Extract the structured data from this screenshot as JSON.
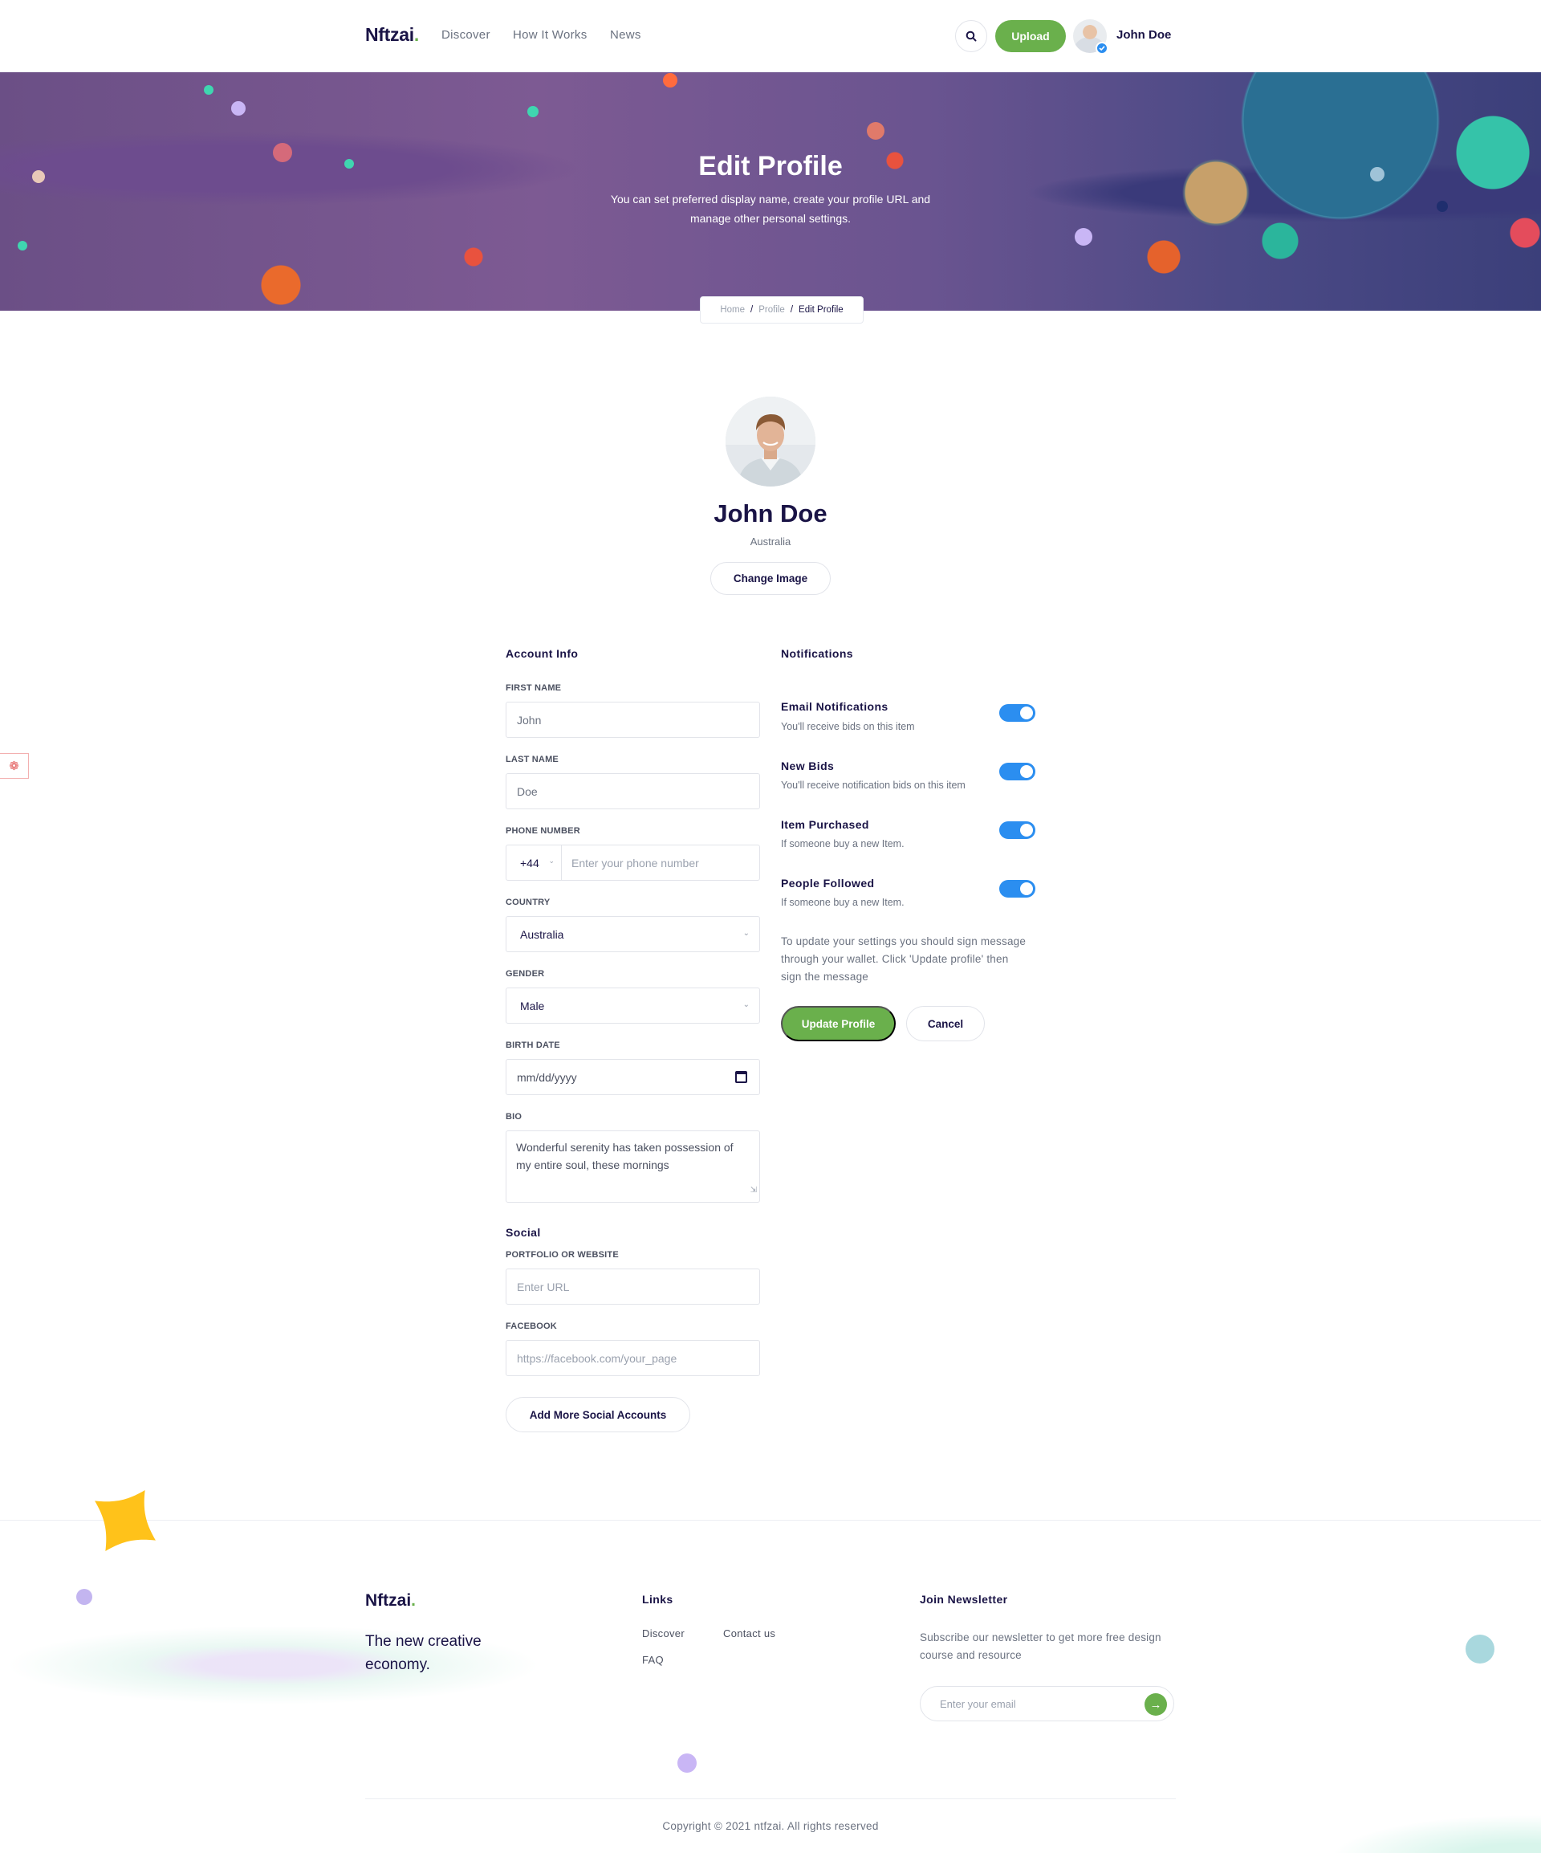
{
  "nav": {
    "logo": "Nftzai",
    "logo_dot": ".",
    "links": [
      "Discover",
      "How It Works",
      "News"
    ],
    "upload_label": "Upload",
    "user_name": "John Doe"
  },
  "hero": {
    "title": "Edit Profile",
    "subtitle": "You can set preferred display name, create your profile URL and manage other personal settings.",
    "breadcrumb": [
      "Home",
      "Profile",
      "Edit Profile"
    ],
    "breadcrumb_sep": "/"
  },
  "profile": {
    "name": "John Doe",
    "country": "Australia",
    "change_image_label": "Change Image"
  },
  "account": {
    "title": "Account Info",
    "first_name": {
      "label": "FIRST NAME",
      "value": "John"
    },
    "last_name": {
      "label": "LAST NAME",
      "value": "Doe"
    },
    "phone": {
      "label": "PHONE NUMBER",
      "code": "+44",
      "placeholder": "Enter your phone number"
    },
    "country": {
      "label": "COUNTRY",
      "value": "Australia"
    },
    "gender": {
      "label": "GENDER",
      "value": "Male"
    },
    "birth_date": {
      "label": "BIRTH DATE",
      "placeholder": "mm/dd/yyyy"
    },
    "bio": {
      "label": "BIO",
      "value": "Wonderful serenity has taken possession of my entire soul, these mornings"
    }
  },
  "social": {
    "title": "Social",
    "website": {
      "label": "PORTFOLIO OR WEBSITE",
      "placeholder": "Enter URL"
    },
    "facebook": {
      "label": "FACEBOOK",
      "placeholder": "https://facebook.com/your_page"
    },
    "add_more_label": "Add More Social Accounts"
  },
  "notifications": {
    "title": "Notifications",
    "items": [
      {
        "title": "Email Notifications",
        "desc": "You'll receive bids on this item",
        "enabled": true
      },
      {
        "title": "New Bids",
        "desc": "You'll receive notification bids on this item",
        "enabled": true
      },
      {
        "title": "Item Purchased",
        "desc": "If someone buy a new Item.",
        "enabled": true
      },
      {
        "title": "People Followed",
        "desc": "If someone buy a new Item.",
        "enabled": true
      }
    ],
    "notice": "To update your settings you should sign message through your wallet. Click 'Update profile' then sign the message",
    "update_label": "Update Profile",
    "cancel_label": "Cancel"
  },
  "footer": {
    "logo": "Nftzai",
    "logo_dot": ".",
    "tagline": "The new creative economy.",
    "links_title": "Links",
    "links": [
      "Discover",
      "Contact us",
      "FAQ"
    ],
    "newsletter_title": "Join Newsletter",
    "newsletter_text": "Subscribe our newsletter to get more free design course and resource",
    "email_placeholder": "Enter your email",
    "copyright": "Copyright © 2021 ntfzai. All rights reserved"
  },
  "colors": {
    "primary_green": "#6ab04c",
    "toggle_blue": "#2b8ef0",
    "navy_text": "#1a1446"
  },
  "icons": {
    "search": "search-icon",
    "verified": "verified-badge-icon",
    "calendar": "calendar-icon",
    "arrow": "arrow-right-icon",
    "chevron": "chevron-down-icon"
  }
}
